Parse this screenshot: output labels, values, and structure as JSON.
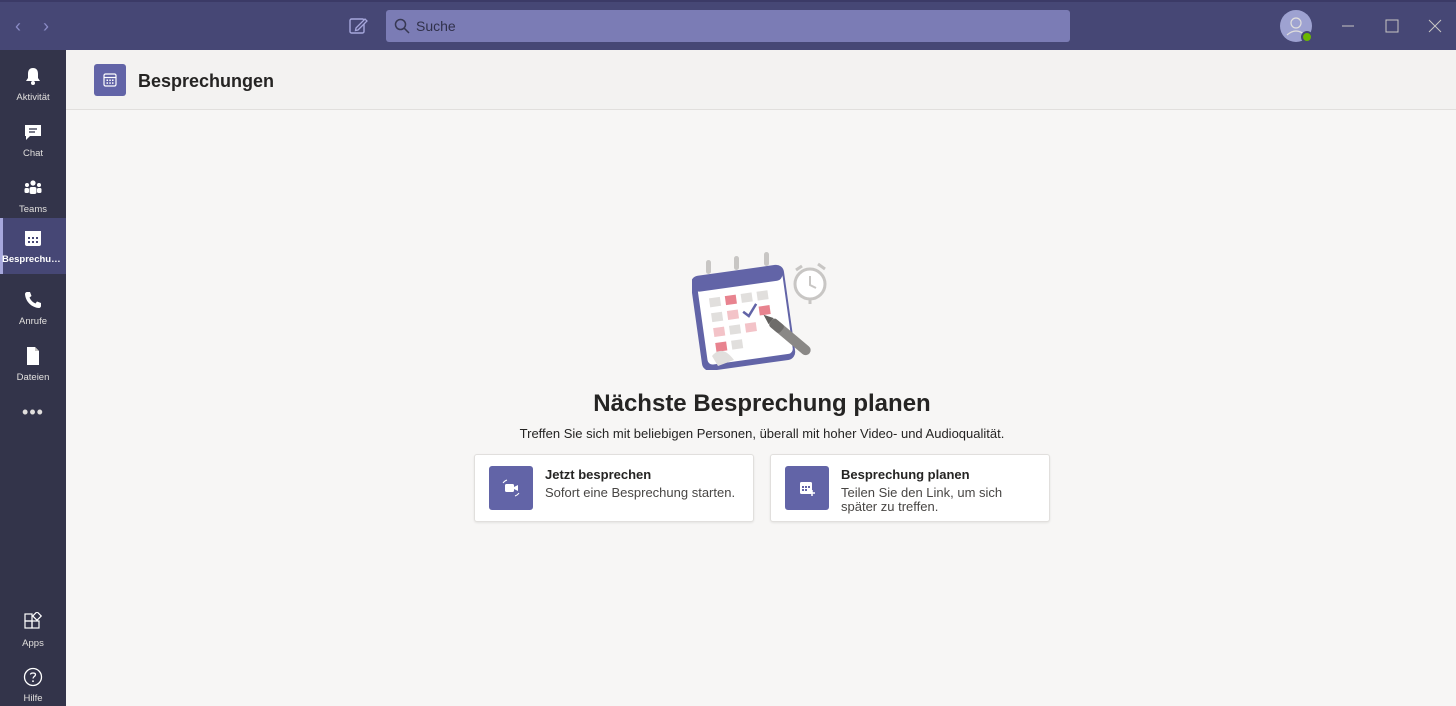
{
  "app": {
    "search": {
      "placeholder": "Suche"
    }
  },
  "rail": {
    "items": [
      {
        "label": "Aktivität",
        "icon": "bell-icon"
      },
      {
        "label": "Chat",
        "icon": "chat-icon"
      },
      {
        "label": "Teams",
        "icon": "teams-icon"
      },
      {
        "label": "Besprechungen",
        "icon": "calendar-icon",
        "active": true
      },
      {
        "label": "Anrufe",
        "icon": "phone-icon"
      },
      {
        "label": "Dateien",
        "icon": "file-icon"
      }
    ],
    "more_label": "•••",
    "bottom": [
      {
        "label": "Apps",
        "icon": "apps-icon"
      },
      {
        "label": "Hilfe",
        "icon": "help-icon"
      }
    ]
  },
  "header": {
    "title": "Besprechungen"
  },
  "main": {
    "title": "Nächste Besprechung planen",
    "subtitle": "Treffen Sie sich mit beliebigen Personen, überall mit hoher Video- und Audioqualität.",
    "cards": [
      {
        "title": "Jetzt besprechen",
        "desc": "Sofort eine Besprechung starten.",
        "icon": "video-icon"
      },
      {
        "title": "Besprechung planen",
        "desc": "Teilen Sie den Link, um sich später zu treffen.",
        "icon": "calendar-add-icon"
      }
    ]
  },
  "colors": {
    "titlebar": "#464775",
    "rail": "#33344a",
    "accent": "#6264a7"
  }
}
